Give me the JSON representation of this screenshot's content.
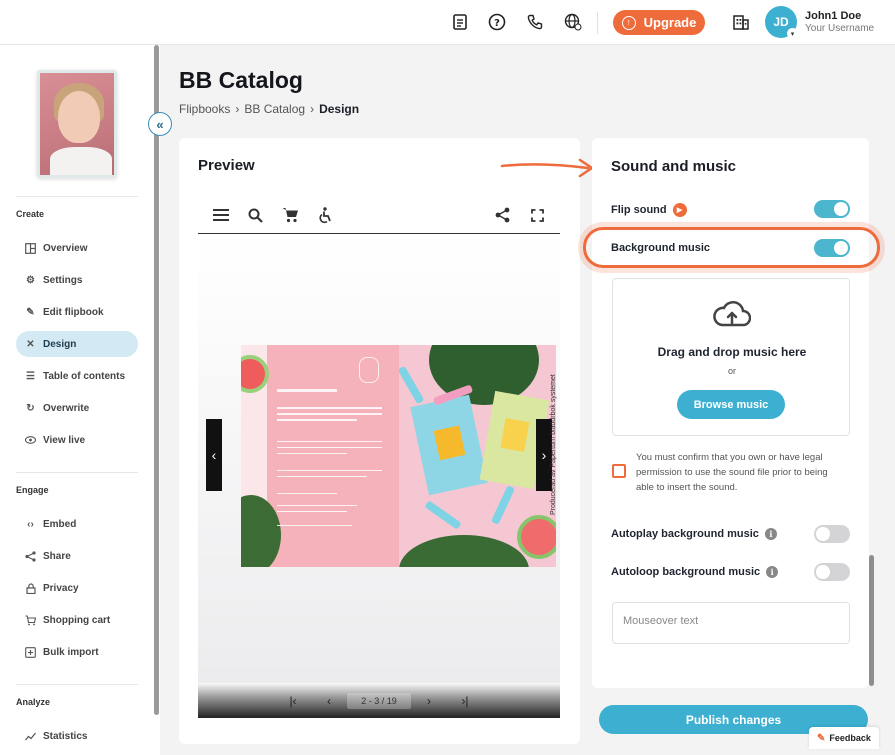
{
  "topbar": {
    "icons": [
      "document-icon",
      "help-icon",
      "phone-icon",
      "language-icon"
    ],
    "upgrade_label": "Upgrade",
    "company_icon": "building-icon",
    "user_initials": "JD",
    "user_name": "John1 Doe",
    "user_subtitle": "Your Username"
  },
  "sidebar": {
    "sections": [
      {
        "title": "Create",
        "items": [
          {
            "label": "Overview",
            "icon": "overview-icon"
          },
          {
            "label": "Settings",
            "icon": "gear-icon"
          },
          {
            "label": "Edit flipbook",
            "icon": "pencil-icon"
          },
          {
            "label": "Design",
            "icon": "design-icon",
            "active": true
          },
          {
            "label": "Table of contents",
            "icon": "toc-icon"
          },
          {
            "label": "Overwrite",
            "icon": "refresh-icon"
          },
          {
            "label": "View live",
            "icon": "eye-icon"
          }
        ]
      },
      {
        "title": "Engage",
        "items": [
          {
            "label": "Embed",
            "icon": "code-icon"
          },
          {
            "label": "Share",
            "icon": "share-icon"
          },
          {
            "label": "Privacy",
            "icon": "lock-icon"
          },
          {
            "label": "Shopping cart",
            "icon": "cart-icon"
          },
          {
            "label": "Bulk import",
            "icon": "import-icon"
          }
        ]
      },
      {
        "title": "Analyze",
        "items": [
          {
            "label": "Statistics",
            "icon": "chart-icon"
          }
        ]
      }
    ]
  },
  "header": {
    "title": "BB Catalog",
    "breadcrumb": [
      "Flipbooks",
      "BB Catalog",
      "Design"
    ]
  },
  "preview": {
    "title": "Preview",
    "produced_by": "Producerad av Paperturn bläddrbok systemet",
    "page_indicator": "2 - 3 / 19"
  },
  "sound": {
    "title": "Sound and music",
    "flip_sound_label": "Flip sound",
    "flip_sound_on": true,
    "background_music_label": "Background music",
    "background_music_on": true,
    "dropzone_title": "Drag and drop music here",
    "dropzone_or": "or",
    "browse_label": "Browse music",
    "confirm_text": "You must confirm that you own or have legal permission to use the sound file prior to being able to insert the sound.",
    "autoplay_label": "Autoplay background music",
    "autoplay_on": false,
    "autoloop_label": "Autoloop background music",
    "autoloop_on": false,
    "mouseover_placeholder": "Mouseover text"
  },
  "footer": {
    "publish_label": "Publish changes",
    "feedback_label": "Feedback"
  },
  "colors": {
    "accent": "#3db0d1",
    "brand_orange": "#ee6b3b"
  }
}
